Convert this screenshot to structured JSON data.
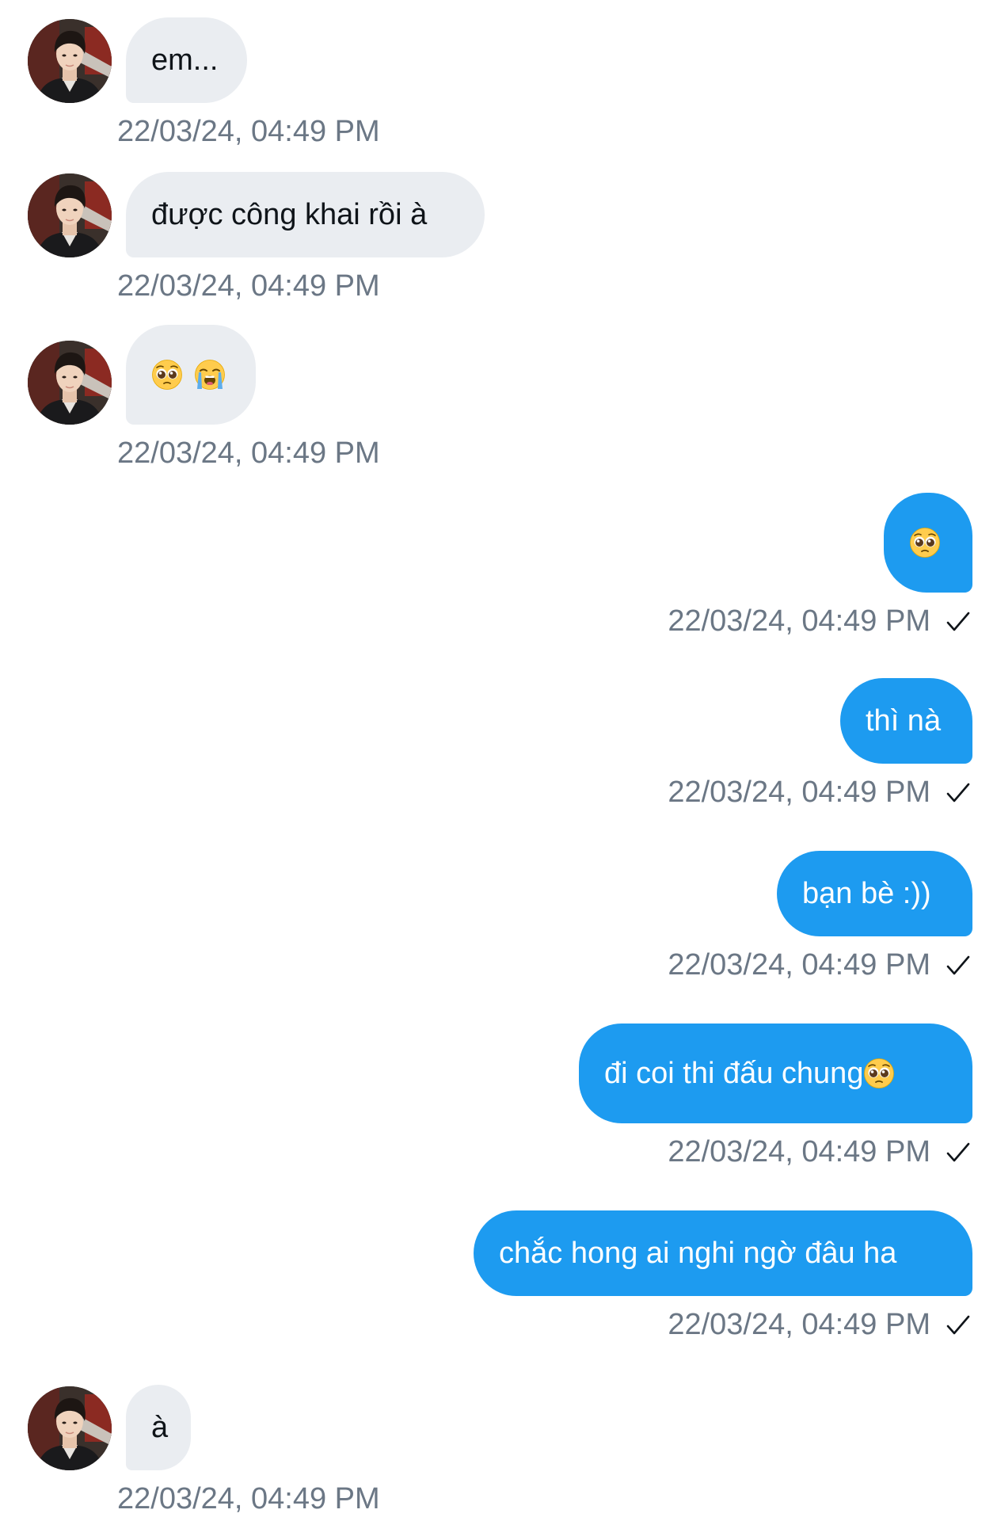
{
  "conversation": {
    "messages": [
      {
        "direction": "incoming",
        "text": "em...",
        "time": "22/03/24, 04:49 PM"
      },
      {
        "direction": "incoming",
        "text": "được công khai rồi à",
        "time": "22/03/24, 04:49 PM"
      },
      {
        "direction": "incoming",
        "emojis": [
          "pleading-face",
          "loudly-crying-face"
        ],
        "time": "22/03/24, 04:49 PM"
      },
      {
        "direction": "outgoing",
        "emojis": [
          "pleading-face"
        ],
        "time": "22/03/24, 04:49 PM",
        "status": "sent"
      },
      {
        "direction": "outgoing",
        "text": "thì nà",
        "time": "22/03/24, 04:49 PM",
        "status": "sent"
      },
      {
        "direction": "outgoing",
        "text": "bạn bè :))",
        "time": "22/03/24, 04:49 PM",
        "status": "sent"
      },
      {
        "direction": "outgoing",
        "text": "đi coi thi đấu chung",
        "trailing_emoji": "pleading-face",
        "time": "22/03/24, 04:49 PM",
        "status": "sent"
      },
      {
        "direction": "outgoing",
        "text": "chắc hong ai nghi ngờ đâu ha",
        "time": "22/03/24, 04:49 PM",
        "status": "sent"
      },
      {
        "direction": "incoming",
        "text": "à",
        "time": "22/03/24, 04:49 PM"
      }
    ]
  },
  "colors": {
    "outgoing_bubble": "#1d9bf0",
    "incoming_bubble": "#eaedf1",
    "timestamp": "#6b7785",
    "text_dark": "#0f1419"
  },
  "icons": {
    "avatar": "user-photo-avatar",
    "status": "checkmark-icon",
    "emoji_pleading": "pleading-face-emoji",
    "emoji_crying": "loudly-crying-face-emoji"
  }
}
